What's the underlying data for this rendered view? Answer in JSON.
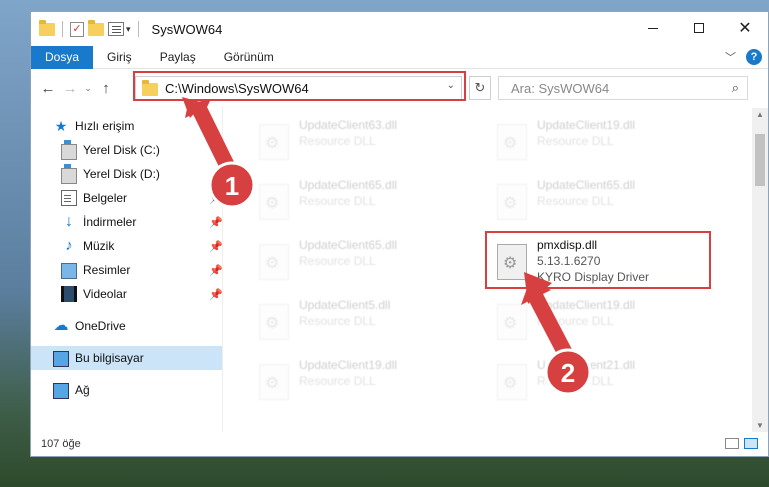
{
  "window": {
    "title": "SysWOW64",
    "controls": {
      "minimize": "minimize-icon",
      "maximize": "maximize-icon",
      "close": "✕"
    }
  },
  "ribbon": {
    "tabs": [
      {
        "label": "Dosya",
        "active": true
      },
      {
        "label": "Giriş"
      },
      {
        "label": "Paylaş"
      },
      {
        "label": "Görünüm"
      }
    ],
    "help": "?",
    "collapse": "﹀"
  },
  "nav": {
    "back": "←",
    "forward": "→",
    "recent": "⌄",
    "up": "↑",
    "address": "C:\\Windows\\SysWOW64",
    "address_dropdown": "⌄",
    "refresh": "↻",
    "search_placeholder": "Ara: SysWOW64",
    "search_icon": "⌕"
  },
  "sidebar": {
    "quick_access": "Hızlı erişim",
    "items": [
      {
        "label": "Yerel Disk (C:)",
        "icon": "drive-icon",
        "pinned": false
      },
      {
        "label": "Yerel Disk (D:)",
        "icon": "drive-icon",
        "pinned": true
      },
      {
        "label": "Belgeler",
        "icon": "documents-icon",
        "pinned": true
      },
      {
        "label": "İndirmeler",
        "icon": "downloads-icon",
        "pinned": true
      },
      {
        "label": "Müzik",
        "icon": "music-icon",
        "pinned": true
      },
      {
        "label": "Resimler",
        "icon": "pictures-icon",
        "pinned": true
      },
      {
        "label": "Videolar",
        "icon": "videos-icon",
        "pinned": true
      }
    ],
    "onedrive": "OneDrive",
    "this_pc": "Bu bilgisayar",
    "network": "Ağ",
    "pin_glyph": "📌"
  },
  "files": {
    "left": [
      {
        "name": "UpdateClient63.dll",
        "desc": "Resource DLL"
      },
      {
        "name": "UpdateClient65.dll",
        "desc": "Resource DLL"
      },
      {
        "name": "UpdateClient65.dll",
        "desc": "Resource DLL"
      },
      {
        "name": "UpdateClient5.dll",
        "desc": "Resource DLL"
      },
      {
        "name": "UpdateClient19.dll",
        "desc": "Resource DLL"
      }
    ],
    "right": [
      {
        "name": "UpdateClient19.dll",
        "desc": "Resource DLL"
      },
      {
        "name": "UpdateClient65.dll",
        "desc": "Resource DLL"
      },
      {
        "name": "UpdateClient19.dll",
        "desc": "Resource DLL"
      },
      {
        "name": "UpdateClient21.dll",
        "desc": "Resource DLL"
      }
    ],
    "focused": {
      "name": "pmxdisp.dll",
      "version": "5.13.1.6270",
      "desc": "KYRO Display Driver"
    }
  },
  "status": {
    "count": "107 öğe"
  },
  "annotations": {
    "badge1": "1",
    "badge2": "2",
    "color": "#d64040"
  }
}
